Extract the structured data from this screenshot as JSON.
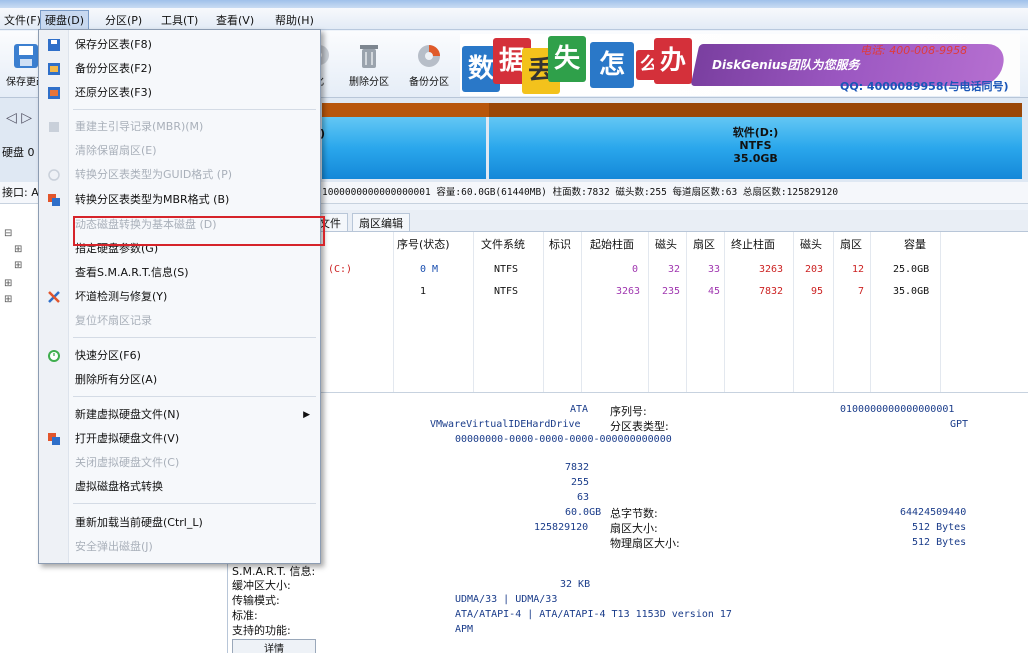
{
  "menubar": {
    "items": [
      "文件(F)",
      "硬盘(D)",
      "分区(P)",
      "工具(T)",
      "查看(V)",
      "帮助(H)"
    ]
  },
  "toolbar": {
    "save_label": "保存更改",
    "items": [
      "化",
      "删除分区",
      "备份分区"
    ]
  },
  "banner": {
    "chars": [
      "数",
      "据",
      "丢",
      "失",
      "怎",
      "么",
      "办"
    ],
    "brand": "DiskGenius团队为您服务",
    "tel": "电话: 400-008-9958",
    "qq": "QQ: 4000089958(与电话同号)"
  },
  "disk_strip": {
    "nav_label": "硬盘 0",
    "iface_label": "接口: A",
    "partition_c_label": ")",
    "partition_d": {
      "name": "软件(D:)",
      "fs": "NTFS",
      "size": "35.0GB"
    }
  },
  "infoline": "1000000000000000001  容量:60.0GB(61440MB)  柱面数:7832  磁头数:255  每道扇区数:63  总扇区数:125829120",
  "tabs": [
    "文件",
    "扇区编辑"
  ],
  "table": {
    "headers": [
      "序号(状态)",
      "文件系统",
      "标识",
      "起始柱面",
      "磁头",
      "扇区",
      "终止柱面",
      "磁头",
      "扇区",
      "容量"
    ],
    "rows": [
      {
        "name": "(C:)",
        "index": "0 M",
        "fs": "NTFS",
        "flag": "",
        "start_cyl": "0",
        "start_head": "32",
        "start_sec": "33",
        "end_cyl": "3263",
        "end_head": "203",
        "end_sec": "12",
        "size": "25.0GB"
      },
      {
        "name": "",
        "index": "1",
        "fs": "NTFS",
        "flag": "",
        "start_cyl": "3263",
        "start_head": "235",
        "start_sec": "45",
        "end_cyl": "7832",
        "end_head": "95",
        "end_sec": "7",
        "size": "35.0GB"
      }
    ]
  },
  "details": {
    "iface": "ATA",
    "model": "VMwareVirtualIDEHardDrive",
    "guid": "00000000-0000-0000-0000-000000000000",
    "serial_label": "序列号:",
    "serial": "0100000000000000001",
    "pt_label": "分区表类型:",
    "pt": "GPT",
    "cyl": "7832",
    "heads": "255",
    "spt": "63",
    "capacity": "60.0GB",
    "sectors": "125829120",
    "total_bytes_label": "总字节数:",
    "total_bytes": "64424509440",
    "sector_size_label": "扇区大小:",
    "sector_size": "512 Bytes",
    "phys_sector_label": "物理扇区大小:",
    "phys_sector": "512 Bytes",
    "smart_label": "S.M.A.R.T. 信息:",
    "buffer_label": "缓冲区大小:",
    "buffer": "32 KB",
    "transfer_label": "传输模式:",
    "transfer": "UDMA/33 | UDMA/33",
    "standard_label": "标准:",
    "standard": "ATA/ATAPI-4 | ATA/ATAPI-4 T13 1153D version 17",
    "features_label": "支持的功能:",
    "features": "APM",
    "detail_button": "详情"
  },
  "disk_menu": {
    "items": [
      {
        "label": "保存分区表(F8)",
        "disabled": false
      },
      {
        "label": "备份分区表(F2)",
        "disabled": false
      },
      {
        "label": "还原分区表(F3)",
        "disabled": false
      },
      {
        "label": "重建主引导记录(MBR)(M)",
        "disabled": true
      },
      {
        "label": "清除保留扇区(E)",
        "disabled": true
      },
      {
        "label": "转换分区表类型为GUID格式 (P)",
        "disabled": true
      },
      {
        "label": "转换分区表类型为MBR格式 (B)",
        "disabled": false
      },
      {
        "label": "动态磁盘转换为基本磁盘 (D)",
        "disabled": true
      },
      {
        "label": "指定硬盘参数(G)",
        "disabled": false
      },
      {
        "label": "查看S.M.A.R.T.信息(S)",
        "disabled": false
      },
      {
        "label": "坏道检测与修复(Y)",
        "disabled": false
      },
      {
        "label": "复位坏扇区记录",
        "disabled": true
      },
      {
        "label": "快速分区(F6)",
        "disabled": false
      },
      {
        "label": "删除所有分区(A)",
        "disabled": false
      },
      {
        "label": "新建虚拟硬盘文件(N)",
        "disabled": false
      },
      {
        "label": "打开虚拟硬盘文件(V)",
        "disabled": false
      },
      {
        "label": "关闭虚拟硬盘文件(C)",
        "disabled": true
      },
      {
        "label": "虚拟磁盘格式转换",
        "disabled": false
      },
      {
        "label": "重新加载当前硬盘(Ctrl_L)",
        "disabled": false
      },
      {
        "label": "安全弹出磁盘(J)",
        "disabled": true
      }
    ]
  },
  "colors": {
    "highlight_border": "#d6242a",
    "partition_blue": "#2aa7ec",
    "partition_top": "#b8560c",
    "menu_accent": "#2f6fc9"
  }
}
